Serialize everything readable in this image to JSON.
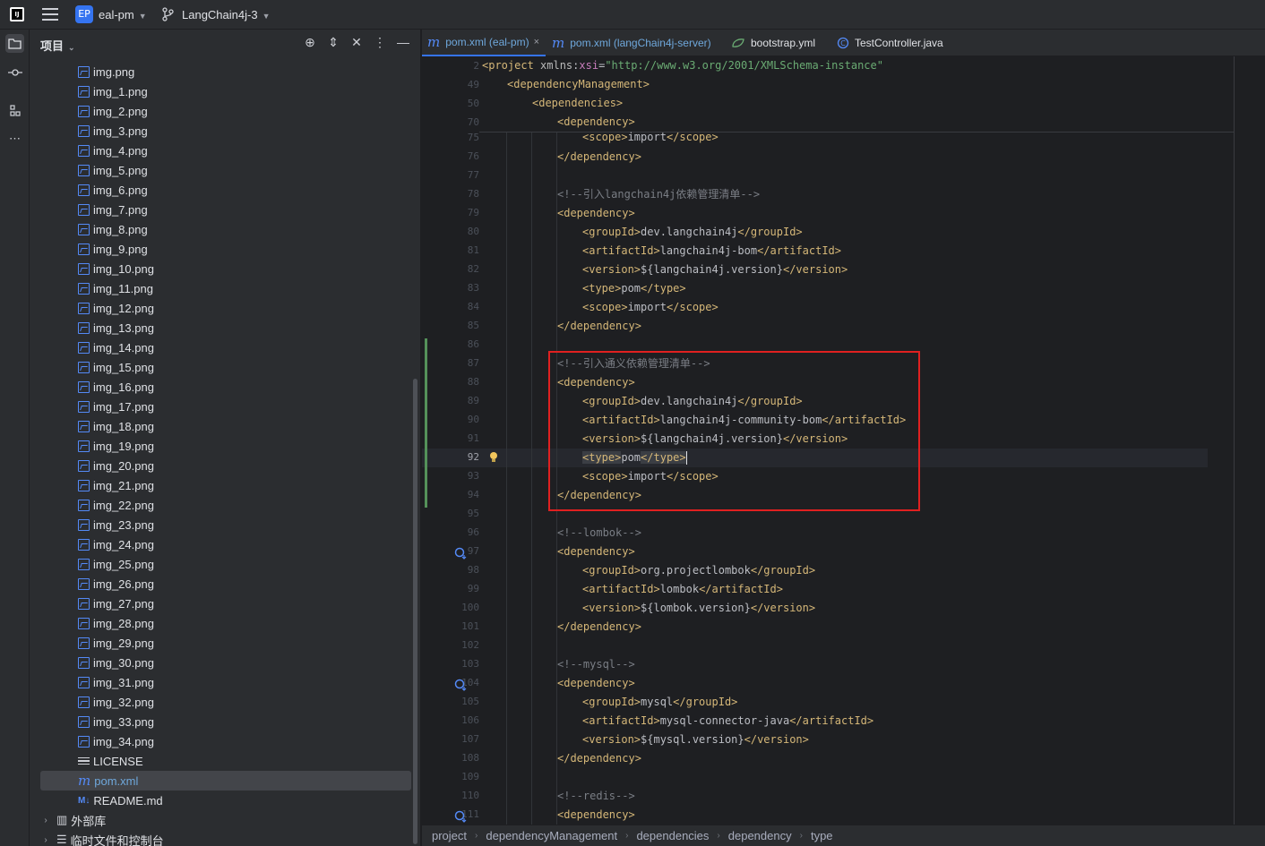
{
  "titlebar": {
    "project_badge": "EP",
    "project_name": "eal-pm",
    "branch_name": "LangChain4j-3"
  },
  "project_panel": {
    "title": "项目",
    "files": [
      "img.png",
      "img_1.png",
      "img_2.png",
      "img_3.png",
      "img_4.png",
      "img_5.png",
      "img_6.png",
      "img_7.png",
      "img_8.png",
      "img_9.png",
      "img_10.png",
      "img_11.png",
      "img_12.png",
      "img_13.png",
      "img_14.png",
      "img_15.png",
      "img_16.png",
      "img_17.png",
      "img_18.png",
      "img_19.png",
      "img_20.png",
      "img_21.png",
      "img_22.png",
      "img_23.png",
      "img_24.png",
      "img_25.png",
      "img_26.png",
      "img_27.png",
      "img_28.png",
      "img_29.png",
      "img_30.png",
      "img_31.png",
      "img_32.png",
      "img_33.png",
      "img_34.png"
    ],
    "license": "LICENSE",
    "pom": "pom.xml",
    "readme": "README.md",
    "external_libs": "外部库",
    "scratches": "临时文件和控制台"
  },
  "tabs": [
    {
      "label": "pom.xml (eal-pm)",
      "close": "×"
    },
    {
      "label": "pom.xml (langChain4j-server)"
    },
    {
      "label": "bootstrap.yml"
    },
    {
      "label": "TestController.java"
    }
  ],
  "editor": {
    "sticky_lines": [
      "2",
      "49",
      "50",
      "70"
    ],
    "line_numbers": [
      "75",
      "76",
      "77",
      "78",
      "79",
      "80",
      "81",
      "82",
      "83",
      "84",
      "85",
      "86",
      "87",
      "88",
      "89",
      "90",
      "91",
      "92",
      "93",
      "94",
      "95",
      "96",
      "97",
      "98",
      "99",
      "100",
      "101",
      "102",
      "103",
      "104",
      "105",
      "106",
      "107",
      "108",
      "109",
      "110",
      "111"
    ],
    "current_line": "92",
    "code": {
      "s1a": "<project ",
      "s1b": "xmlns",
      "s1c": ":",
      "s1d": "xsi",
      "s1e": "=",
      "s1f": "\"http://www.w3.org/2001/XMLSchema-instance\"",
      "s2": "<dependencyManagement>",
      "s3": "<dependencies>",
      "s4": "<dependency>",
      "l75a": "<scope>",
      "l75b": "import",
      "l75c": "</scope>",
      "l76": "</dependency>",
      "l78": "<!--引入langchain4j依赖管理清单-->",
      "l79": "<dependency>",
      "l80a": "<groupId>",
      "l80b": "dev.langchain4j",
      "l80c": "</groupId>",
      "l81a": "<artifactId>",
      "l81b": "langchain4j-bom",
      "l81c": "</artifactId>",
      "l82a": "<version>",
      "l82b": "${langchain4j.version}",
      "l82c": "</version>",
      "l83a": "<type>",
      "l83b": "pom",
      "l83c": "</type>",
      "l84a": "<scope>",
      "l84b": "import",
      "l84c": "</scope>",
      "l85": "</dependency>",
      "l87": "<!--引入通义依赖管理清单-->",
      "l88": "<dependency>",
      "l89a": "<groupId>",
      "l89b": "dev.langchain4j",
      "l89c": "</groupId>",
      "l90a": "<artifactId>",
      "l90b": "langchain4j-community-bom",
      "l90c": "</artifactId>",
      "l91a": "<version>",
      "l91b": "${langchain4j.version}",
      "l91c": "</version>",
      "l92a": "<type>",
      "l92b": "pom",
      "l92c": "</type>",
      "l93a": "<scope>",
      "l93b": "import",
      "l93c": "</scope>",
      "l94": "</dependency>",
      "l96": "<!--lombok-->",
      "l97": "<dependency>",
      "l98a": "<groupId>",
      "l98b": "org.projectlombok",
      "l98c": "</groupId>",
      "l99a": "<artifactId>",
      "l99b": "lombok",
      "l99c": "</artifactId>",
      "l100a": "<version>",
      "l100b": "${lombok.version}",
      "l100c": "</version>",
      "l101": "</dependency>",
      "l103": "<!--mysql-->",
      "l104": "<dependency>",
      "l105a": "<groupId>",
      "l105b": "mysql",
      "l105c": "</groupId>",
      "l106a": "<artifactId>",
      "l106b": "mysql-connector-java",
      "l106c": "</artifactId>",
      "l107a": "<version>",
      "l107b": "${mysql.version}",
      "l107c": "</version>",
      "l108": "</dependency>",
      "l110": "<!--redis-->",
      "l111": "<dependency>"
    }
  },
  "breadcrumbs": [
    "project",
    "dependencyManagement",
    "dependencies",
    "dependency",
    "type"
  ],
  "colors": {
    "accent": "#3574f0",
    "highlight_box": "#e02020",
    "tag": "#d5b778",
    "string": "#6aab73"
  }
}
